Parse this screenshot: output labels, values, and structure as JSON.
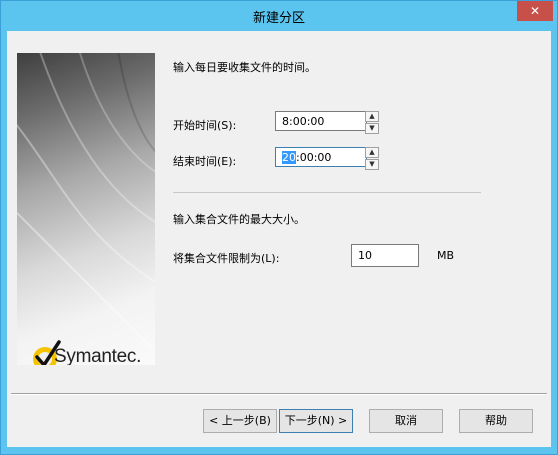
{
  "window": {
    "title": "新建分区",
    "close_glyph": "✕"
  },
  "brand": {
    "name": "Symantec",
    "mark": "."
  },
  "intro_text": "输入每日要收集文件的时间。",
  "start_time": {
    "label": "开始时间(S):",
    "value": "8:00:00"
  },
  "end_time": {
    "label": "结束时间(E):",
    "value_selected": "20",
    "value_rest": ":00:00"
  },
  "size_section_text": "输入集合文件的最大大小。",
  "limit": {
    "label": "将集合文件限制为(L):",
    "value": "10",
    "unit": "MB"
  },
  "buttons": {
    "back": "< 上一步(B)",
    "next": "下一步(N) >",
    "cancel": "取消",
    "help": "帮助"
  },
  "spinner_glyphs": {
    "up": "▲",
    "down": "▼"
  }
}
